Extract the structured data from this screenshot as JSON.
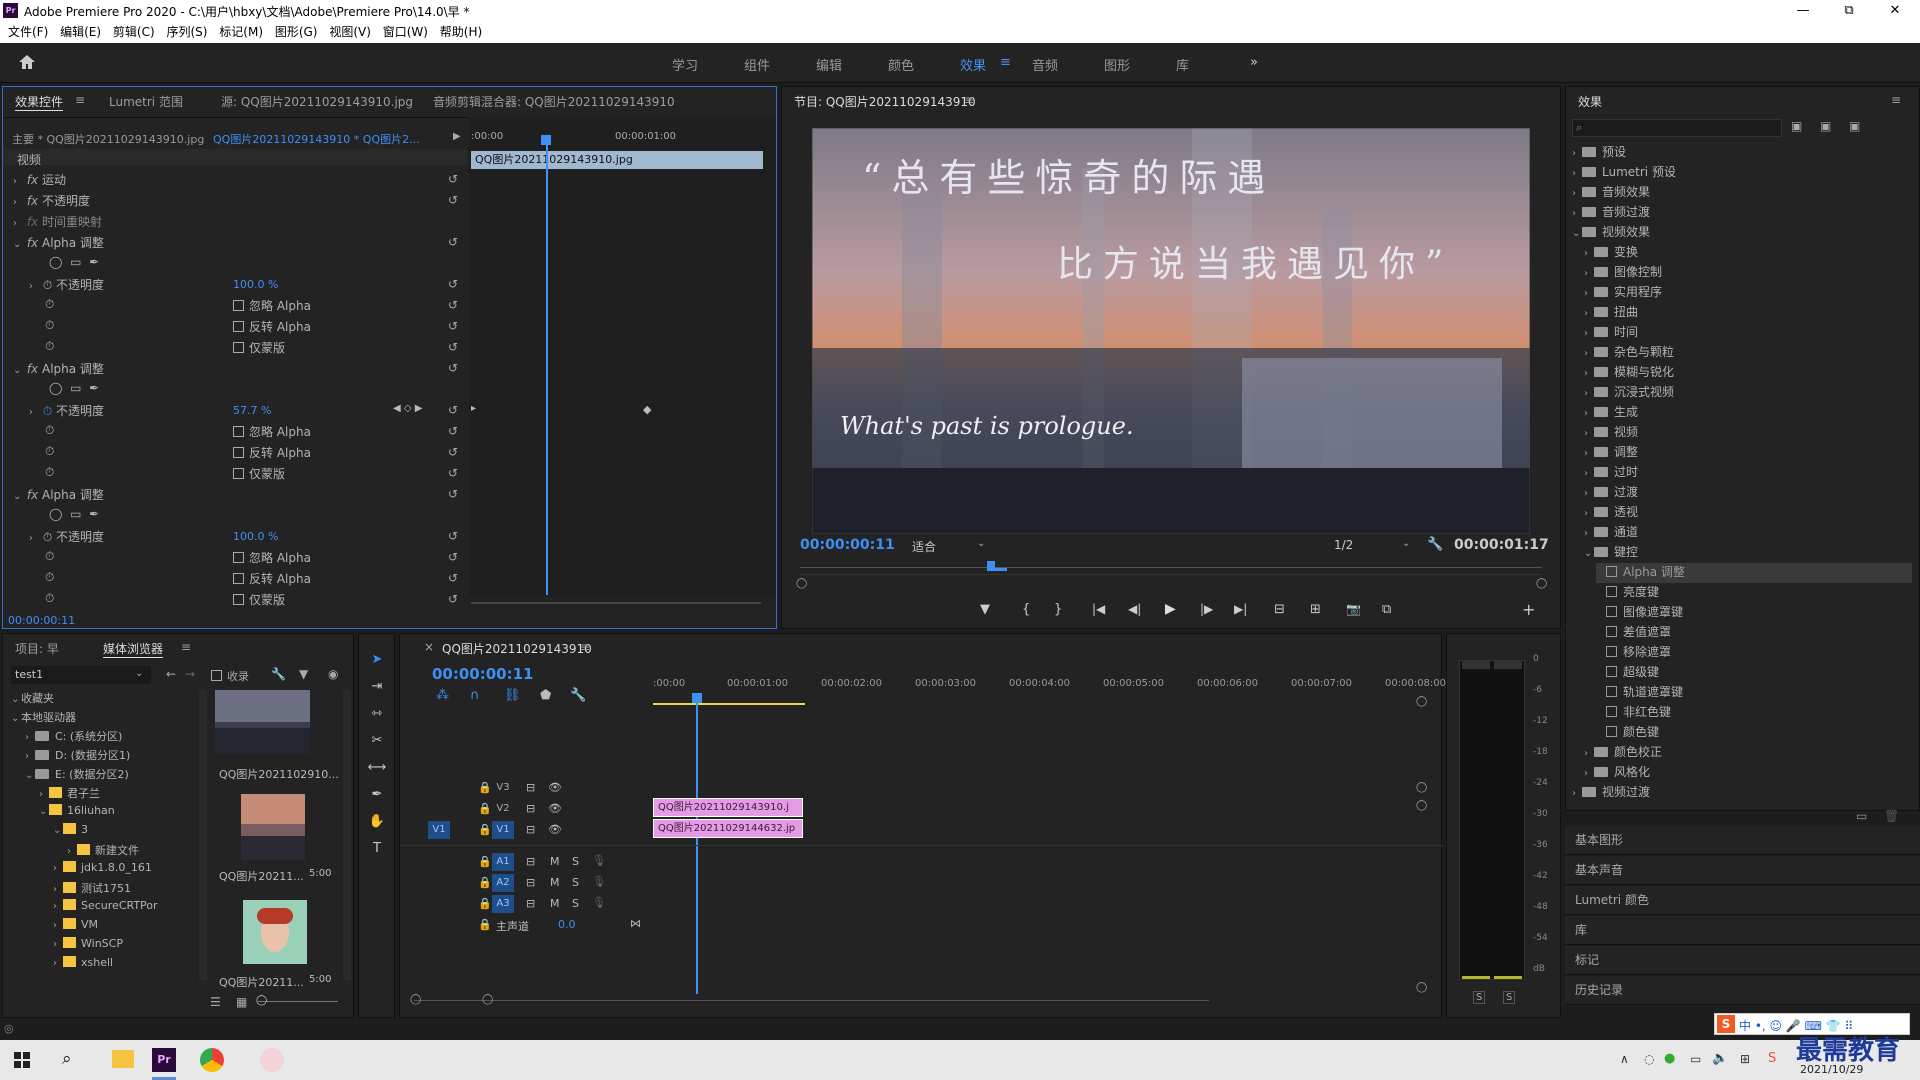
{
  "app": {
    "title": "Adobe Premiere Pro 2020 - C:\\用户\\hbxy\\文档\\Adobe\\Premiere Pro\\14.0\\早 *",
    "logo": "Pr"
  },
  "window_controls": {
    "minimize": "—",
    "maximize": "⧉",
    "close": "✕"
  },
  "menu": [
    "文件(F)",
    "编辑(E)",
    "剪辑(C)",
    "序列(S)",
    "标记(M)",
    "图形(G)",
    "视图(V)",
    "窗口(W)",
    "帮助(H)"
  ],
  "workspaces": [
    "学习",
    "组件",
    "编辑",
    "颜色",
    "效果",
    "音频",
    "图形",
    "库"
  ],
  "workspace_active": "效果",
  "workspace_more": "»",
  "effect_controls": {
    "tabs": [
      "效果控件",
      "Lumetri 范围",
      "源: QQ图片20211029143910.jpg",
      "音频剪辑混合器: QQ图片20211029143910"
    ],
    "master": "主要 * QQ图片20211029143910.jpg",
    "sequence_clip": "QQ图片20211029143910 * QQ图片2...",
    "ruler_start": ":00:00",
    "ruler_mid": "00:00:01:00",
    "clip_bar": "QQ图片20211029143910.jpg",
    "section": "视频",
    "motion": "运动",
    "opacity": "不透明度",
    "time_remap": "时间重映射",
    "alpha_label": "Alpha 调整",
    "opacity_param": "不透明度",
    "ignore_alpha": "忽略 Alpha",
    "invert_alpha": "反转 Alpha",
    "mask_only": "仅蒙版",
    "opacity_values": [
      "100.0 %",
      "57.7 %",
      "100.0 %"
    ],
    "timecode": "00:00:00:11"
  },
  "program": {
    "title": "节目: QQ图片20211029143910",
    "overlay_line1": "“总有些惊奇的际遇",
    "overlay_line2": "比方说当我遇见你”",
    "overlay_en": "What's past is prologue.",
    "timecode": "00:00:00:11",
    "fit": "适合",
    "res": "1/2",
    "duration": "00:00:01:17",
    "transport": [
      "▼",
      "{",
      "}",
      "|◀",
      "◀|",
      "▶",
      "|▶",
      "▶|",
      "⊟",
      "⊞",
      "📷",
      "⧉",
      "+"
    ]
  },
  "effects_panel": {
    "title": "效果",
    "search_placeholder": "",
    "top_items": [
      "预设",
      "Lumetri 预设",
      "音频效果",
      "音频过渡",
      "视频效果"
    ],
    "video_effects": [
      "变换",
      "图像控制",
      "实用程序",
      "扭曲",
      "时间",
      "杂色与颗粒",
      "模糊与锐化",
      "沉浸式视频",
      "生成",
      "视频",
      "调整",
      "过时",
      "过渡",
      "透视",
      "通道",
      "键控"
    ],
    "keying": [
      "Alpha 调整",
      "亮度键",
      "图像遮罩键",
      "差值遮罩",
      "移除遮罩",
      "超级键",
      "轨道遮罩键",
      "非红色键",
      "颜色键"
    ],
    "after": [
      "颜色校正",
      "风格化"
    ],
    "video_transitions": "视频过渡",
    "collapsed_panels": [
      "基本图形",
      "基本声音",
      "Lumetri 颜色",
      "库",
      "标记",
      "历史记录"
    ]
  },
  "project": {
    "tabs": [
      "项目: 早",
      "媒体浏览器"
    ],
    "location": "test1",
    "collect_label": "收录",
    "tree": [
      {
        "label": "收藏夹",
        "indent": 0,
        "type": "none"
      },
      {
        "label": "本地驱动器",
        "indent": 0,
        "type": "none"
      },
      {
        "label": "C: (系统分区)",
        "indent": 1,
        "type": "drive"
      },
      {
        "label": "D: (数据分区1)",
        "indent": 1,
        "type": "drive"
      },
      {
        "label": "E: (数据分区2)",
        "indent": 1,
        "type": "drive"
      },
      {
        "label": "君子兰",
        "indent": 2,
        "type": "folder"
      },
      {
        "label": "16liuhan",
        "indent": 2,
        "type": "folder"
      },
      {
        "label": "3",
        "indent": 3,
        "type": "folder"
      },
      {
        "label": "新建文件",
        "indent": 4,
        "type": "folder"
      },
      {
        "label": "jdk1.8.0_161",
        "indent": 3,
        "type": "folder"
      },
      {
        "label": "测试1751",
        "indent": 3,
        "type": "folder"
      },
      {
        "label": "SecureCRTPor",
        "indent": 3,
        "type": "folder"
      },
      {
        "label": "VM",
        "indent": 3,
        "type": "folder"
      },
      {
        "label": "WinSCP",
        "indent": 3,
        "type": "folder"
      },
      {
        "label": "xshell",
        "indent": 3,
        "type": "folder"
      }
    ],
    "thumbs": [
      {
        "label": "QQ图片2021102910...",
        "dur": ""
      },
      {
        "label": "QQ图片20211...",
        "dur": "5:00"
      },
      {
        "label": "QQ图片20211...",
        "dur": "5:00"
      }
    ]
  },
  "timeline": {
    "title": "QQ图片20211029143910",
    "timecode": "00:00:00:11",
    "ruler": [
      ":00:00",
      "00:00:01:00",
      "00:00:02:00",
      "00:00:03:00",
      "00:00:04:00",
      "00:00:05:00",
      "00:00:06:00",
      "00:00:07:00",
      "00:00:08:00"
    ],
    "video_tracks": [
      "V3",
      "V2",
      "V1"
    ],
    "audio_tracks": [
      "A1",
      "A2",
      "A3"
    ],
    "source_patch": "V1",
    "master": "主声道",
    "master_val": "0.0",
    "clips": [
      {
        "label": "QQ图片20211029143910.j"
      },
      {
        "label": "QQ图片20211029144632.jp"
      }
    ],
    "mute": "M",
    "solo": "S"
  },
  "meter": {
    "labels": [
      "0",
      "-6",
      "-12",
      "-18",
      "-24",
      "-30",
      "-36",
      "-42",
      "-48",
      "-54",
      "dB"
    ],
    "solo": [
      "S",
      "S"
    ]
  },
  "taskbar": {
    "date": "2021/10/29",
    "watermark": "最需教育",
    "ime": "中 •, ☺ 🎤 ⌨ 👕 ⠿"
  },
  "colors": {
    "accent": "#2f6fd8",
    "clip": "#e59ae5",
    "timecode": "#3f8ff5",
    "playhead": "#3f8ff5"
  }
}
